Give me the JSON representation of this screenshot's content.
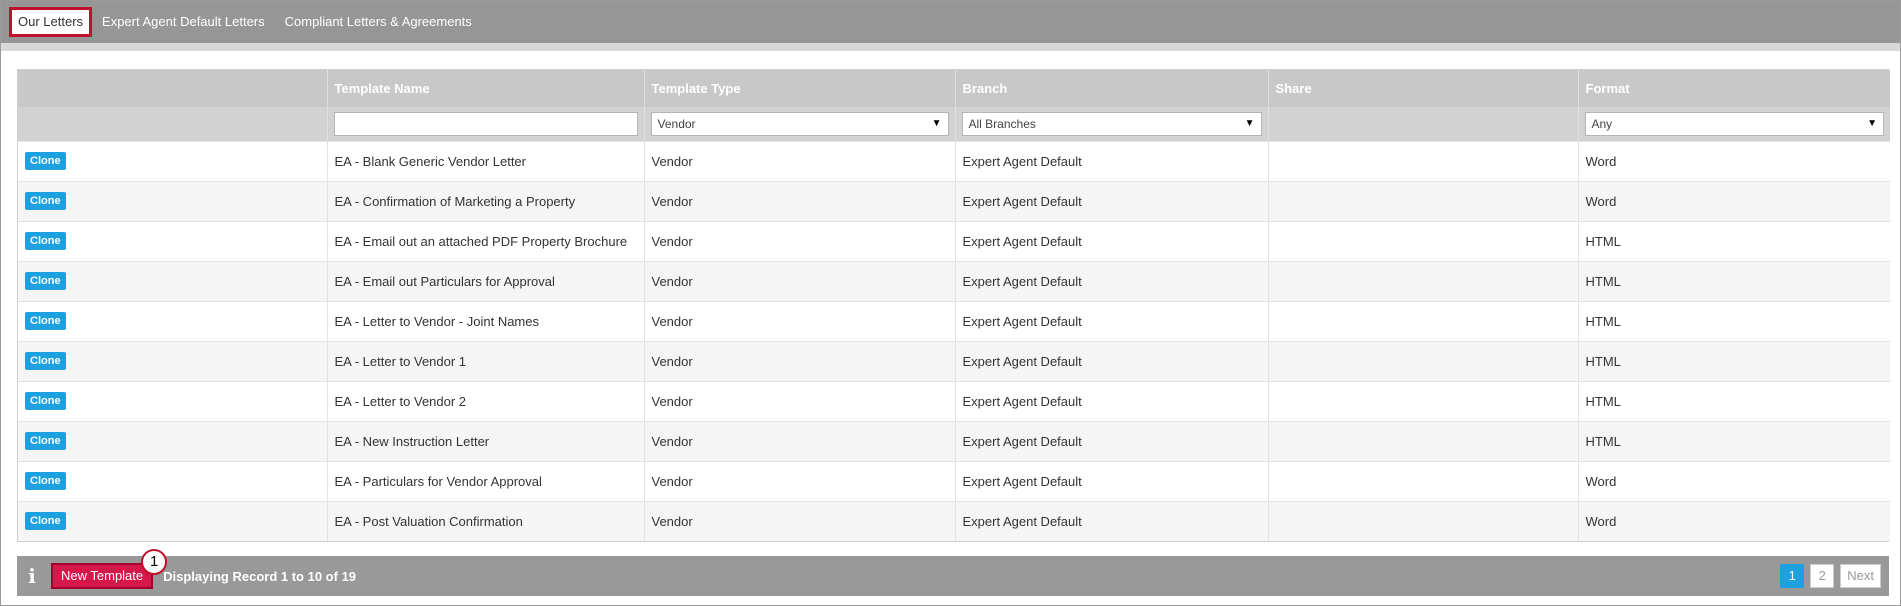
{
  "tabs": [
    {
      "label": "Our Letters",
      "active": true
    },
    {
      "label": "Expert Agent Default Letters",
      "active": false
    },
    {
      "label": "Compliant Letters & Agreements",
      "active": false
    }
  ],
  "table": {
    "columns": [
      "",
      "Template Name",
      "Template Type",
      "Branch",
      "Share",
      "Format"
    ],
    "filters": {
      "template_name": "",
      "template_type": "Vendor",
      "branch": "All Branches",
      "format": "Any"
    },
    "clone_label": "Clone",
    "rows": [
      {
        "name": "EA - Blank Generic Vendor Letter",
        "type": "Vendor",
        "branch": "Expert Agent Default",
        "share": "",
        "format": "Word"
      },
      {
        "name": "EA - Confirmation of Marketing a Property",
        "type": "Vendor",
        "branch": "Expert Agent Default",
        "share": "",
        "format": "Word"
      },
      {
        "name": "EA - Email out an attached PDF Property Brochure",
        "type": "Vendor",
        "branch": "Expert Agent Default",
        "share": "",
        "format": "HTML"
      },
      {
        "name": "EA - Email out Particulars for Approval",
        "type": "Vendor",
        "branch": "Expert Agent Default",
        "share": "",
        "format": "HTML"
      },
      {
        "name": "EA - Letter to Vendor - Joint Names",
        "type": "Vendor",
        "branch": "Expert Agent Default",
        "share": "",
        "format": "HTML"
      },
      {
        "name": "EA - Letter to Vendor 1",
        "type": "Vendor",
        "branch": "Expert Agent Default",
        "share": "",
        "format": "HTML"
      },
      {
        "name": "EA - Letter to Vendor 2",
        "type": "Vendor",
        "branch": "Expert Agent Default",
        "share": "",
        "format": "HTML"
      },
      {
        "name": "EA - New Instruction Letter",
        "type": "Vendor",
        "branch": "Expert Agent Default",
        "share": "",
        "format": "HTML"
      },
      {
        "name": "EA - Particulars for Vendor Approval",
        "type": "Vendor",
        "branch": "Expert Agent Default",
        "share": "",
        "format": "Word"
      },
      {
        "name": "EA - Post Valuation Confirmation",
        "type": "Vendor",
        "branch": "Expert Agent Default",
        "share": "",
        "format": "Word"
      }
    ]
  },
  "footer": {
    "info_icon": "i",
    "new_template_label": "New Template",
    "callout_number": "1",
    "display_text": "Displaying Record 1 to 10 of 19",
    "pages": [
      "1",
      "2"
    ],
    "current_page": "1",
    "next_label": "Next"
  },
  "colors": {
    "accent": "#1da1e0",
    "highlight": "#d5174a",
    "header_bg": "#969696"
  }
}
